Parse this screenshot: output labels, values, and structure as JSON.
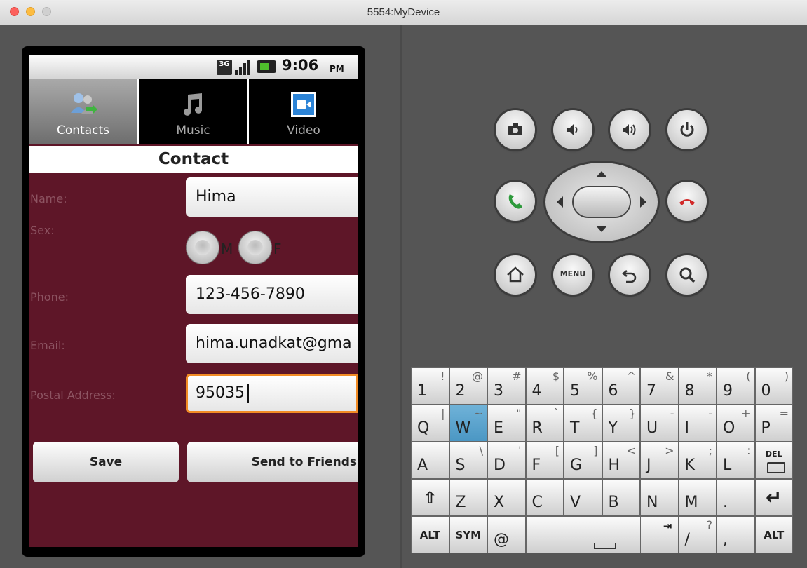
{
  "window": {
    "title": "5554:MyDevice"
  },
  "status_bar": {
    "network": "3G",
    "time": "9:06",
    "ampm": "PM"
  },
  "tabs": [
    {
      "label": "Contacts",
      "icon": "contacts-icon",
      "selected": true
    },
    {
      "label": "Music",
      "icon": "music-note-icon",
      "selected": false
    },
    {
      "label": "Video",
      "icon": "video-camera-icon",
      "selected": false
    }
  ],
  "header": "Contact",
  "form": {
    "name_label": "Name:",
    "name_value": "Hima",
    "sex_label": "Sex:",
    "sex_options": [
      "M",
      "F"
    ],
    "phone_label": "Phone:",
    "phone_value": "123-456-7890",
    "email_label": "Email:",
    "email_value": "hima.unadkat@gma",
    "postal_label": "Postal Address:",
    "postal_value": "95035"
  },
  "buttons": {
    "save": "Save",
    "send": "Send to Friends"
  },
  "hardware": {
    "menu_label": "MENU"
  },
  "keyboard": {
    "row1": [
      [
        "1",
        "!"
      ],
      [
        "2",
        "@"
      ],
      [
        "3",
        "#"
      ],
      [
        "4",
        "$"
      ],
      [
        "5",
        "%"
      ],
      [
        "6",
        "^"
      ],
      [
        "7",
        "&"
      ],
      [
        "8",
        "*"
      ],
      [
        "9",
        "("
      ],
      [
        "0",
        ")"
      ]
    ],
    "row2": [
      [
        "Q",
        "|"
      ],
      [
        "W",
        "~"
      ],
      [
        "E",
        "\""
      ],
      [
        "R",
        "`"
      ],
      [
        "T",
        "{"
      ],
      [
        "Y",
        "}"
      ],
      [
        "U",
        "-"
      ],
      [
        "I",
        "-"
      ],
      [
        "O",
        "+"
      ],
      [
        "P",
        "="
      ]
    ],
    "row3": [
      [
        "A",
        ""
      ],
      [
        "S",
        "\\"
      ],
      [
        "D",
        "'"
      ],
      [
        "F",
        "["
      ],
      [
        "G",
        "]"
      ],
      [
        "H",
        "<"
      ],
      [
        "J",
        ">"
      ],
      [
        "K",
        ";"
      ],
      [
        "L",
        ":"
      ]
    ],
    "row4": [
      "Z",
      "X",
      "C",
      "V",
      "B",
      "N",
      "M",
      "."
    ],
    "row5": {
      "alt": "ALT",
      "sym": "SYM",
      "at": "@",
      "slash": "/",
      "slash_alt": "?",
      "comma": ",",
      "alt_right": "ALT"
    },
    "del": "DEL",
    "highlighted_key": "W",
    "colors": {
      "highlight": "#5aa6d2"
    }
  },
  "colors": {
    "screen_bg": "#5e1628",
    "focus": "#f28c25",
    "emulator_bg": "#555555"
  }
}
